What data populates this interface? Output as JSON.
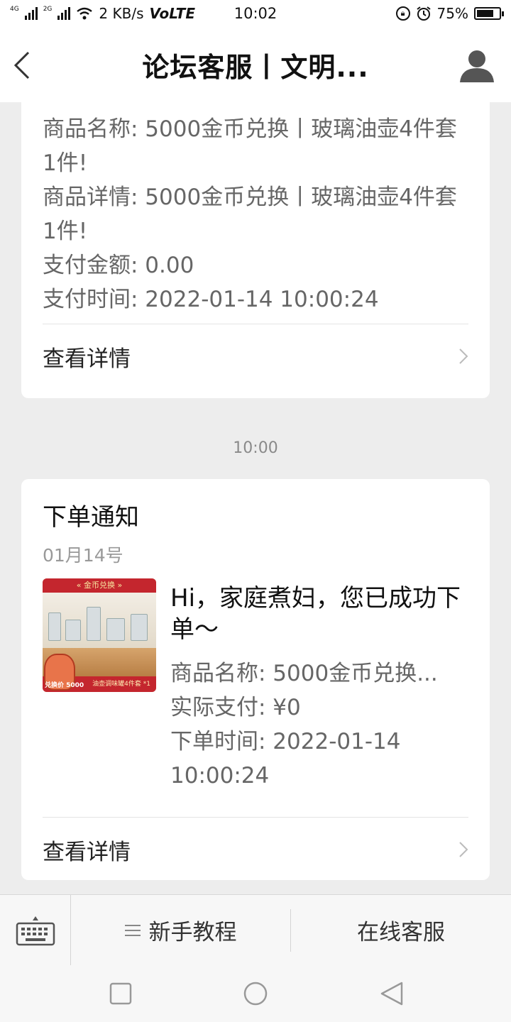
{
  "status_bar": {
    "network_1": "4G",
    "network_2": "2G",
    "speed": "2 KB/s",
    "volte": "VoLTE",
    "time": "10:02",
    "battery": "75%",
    "battery_level": 0.75
  },
  "header": {
    "title": "论坛客服丨文明..."
  },
  "card1": {
    "lines": [
      "商品名称: 5000金币兑换丨玻璃油壶4件套1件!",
      "商品详情: 5000金币兑换丨玻璃油壶4件套1件!",
      "支付金额: 0.00",
      "支付时间: 2022-01-14 10:00:24"
    ],
    "detail_label": "查看详情"
  },
  "timestamp": "10:00",
  "card2": {
    "title": "下单通知",
    "date": "01月14号",
    "thumb": {
      "top_label": "« 金币兑换 »",
      "bottom_label": "油壶调味罐4件套 *1",
      "price_label": "兑换价 5000"
    },
    "headline": "Hi，家庭煮妇，您已成功下单～",
    "lines": [
      "商品名称: 5000金币兑换...",
      "实际支付: ¥0",
      "下单时间: 2022-01-14 10:00:24"
    ],
    "detail_label": "查看详情"
  },
  "menu": {
    "item1": "新手教程",
    "item2": "在线客服"
  }
}
